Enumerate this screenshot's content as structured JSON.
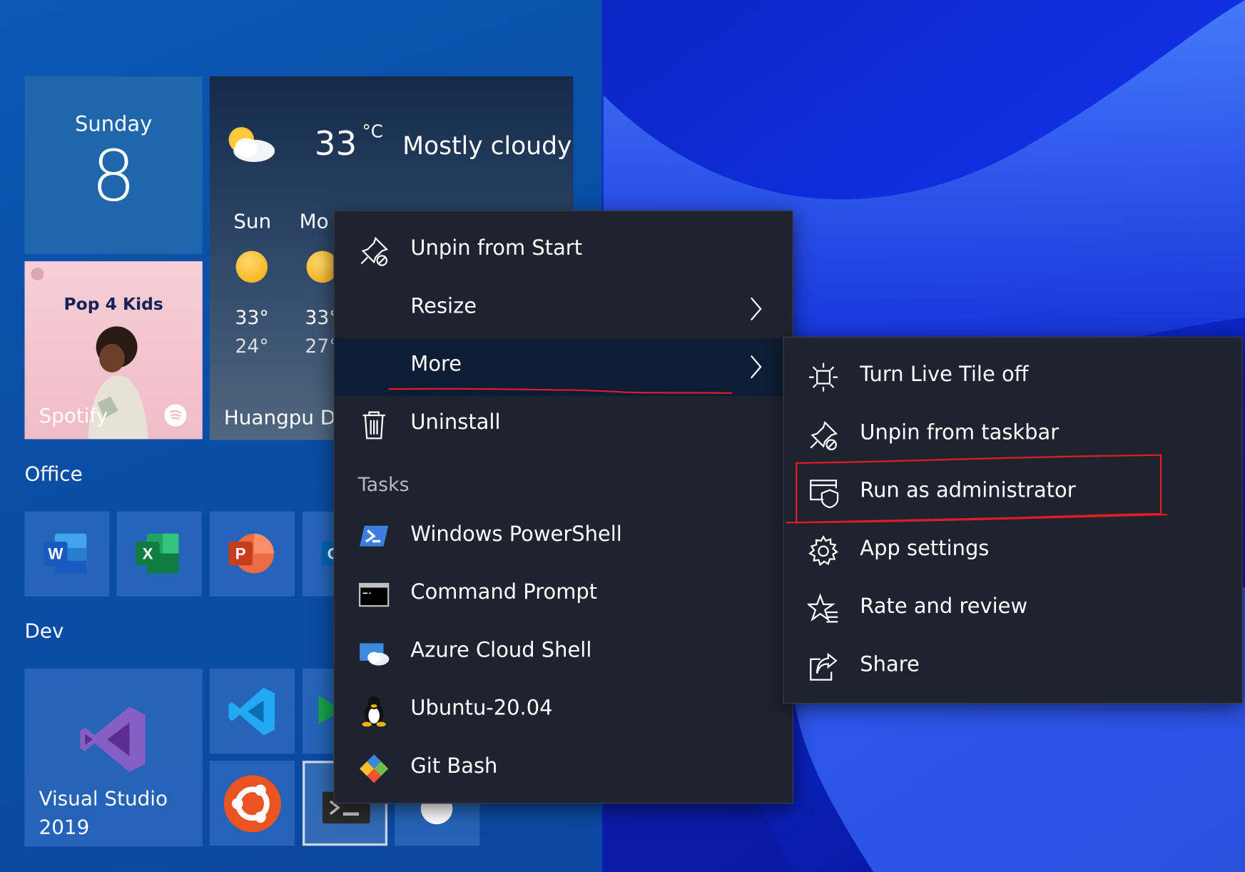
{
  "colors": {
    "accent_red": "#e41b23",
    "menu_bg": "#1f2330",
    "menu_active": "#0e1d35"
  },
  "start": {
    "calendar": {
      "day": "Sunday",
      "date": "8"
    },
    "weather": {
      "temp": "33",
      "unit": "°C",
      "condition": "Mostly cloudy",
      "days": [
        {
          "name": "Sun",
          "hi": "33°",
          "lo": "24°"
        },
        {
          "name": "Mo",
          "hi": "33°",
          "lo": "27°"
        }
      ],
      "city": "Huangpu D"
    },
    "spotify": {
      "title": "Pop 4 Kids",
      "label": "Spotify"
    },
    "groups": {
      "office": "Office",
      "dev": "Dev"
    },
    "office_apps": [
      {
        "name": "Word",
        "letter": "W",
        "color": "#185abd"
      },
      {
        "name": "Excel",
        "letter": "X",
        "color": "#107c41"
      },
      {
        "name": "PowerPoint",
        "letter": "P",
        "color": "#c43e1c"
      },
      {
        "name": "Outlook",
        "letter": "O",
        "color": "#0364b8"
      }
    ],
    "visual_studio": {
      "label": "Visual Studio 2019"
    }
  },
  "context_menu": {
    "items": [
      {
        "label": "Unpin from Start",
        "icon": "unpin-icon"
      },
      {
        "label": "Resize",
        "icon": "none",
        "submenu": true
      },
      {
        "label": "More",
        "icon": "none",
        "submenu": true,
        "active": true
      },
      {
        "label": "Uninstall",
        "icon": "trash-icon"
      }
    ],
    "tasks_header": "Tasks",
    "tasks": [
      {
        "label": "Windows PowerShell",
        "icon": "powershell-icon"
      },
      {
        "label": "Command Prompt",
        "icon": "cmd-icon"
      },
      {
        "label": "Azure Cloud Shell",
        "icon": "azure-icon"
      },
      {
        "label": "Ubuntu-20.04",
        "icon": "linux-icon"
      },
      {
        "label": "Git Bash",
        "icon": "git-icon"
      }
    ]
  },
  "submenu": {
    "items": [
      {
        "label": "Turn Live Tile off",
        "icon": "live-tile-icon"
      },
      {
        "label": "Unpin from taskbar",
        "icon": "unpin-icon"
      },
      {
        "label": "Run as administrator",
        "icon": "shield-window-icon",
        "highlighted": true
      },
      {
        "label": "App settings",
        "icon": "gear-icon"
      },
      {
        "label": "Rate and review",
        "icon": "star-list-icon"
      },
      {
        "label": "Share",
        "icon": "share-icon"
      }
    ]
  }
}
